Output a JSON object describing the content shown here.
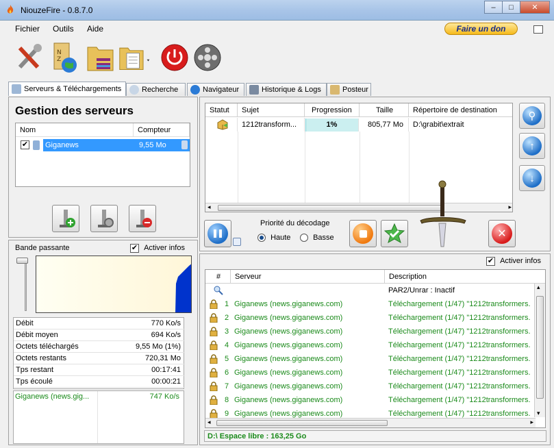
{
  "window": {
    "title": "NiouzeFire - 0.8.7.0",
    "controls": {
      "minimize": "–",
      "maximize": "□",
      "close": "✕"
    }
  },
  "menu": {
    "fichier": "Fichier",
    "outils": "Outils",
    "aide": "Aide",
    "donate": "Faire un don"
  },
  "toolbar": {
    "icons": [
      "tools-icon",
      "nzb-globe-icon",
      "archive-folder-icon",
      "document-folder-icon",
      "power-icon",
      "reel-icon"
    ]
  },
  "tabs": [
    {
      "label": "Serveurs & Téléchargements",
      "active": true
    },
    {
      "label": "Recherche"
    },
    {
      "label": "Navigateur"
    },
    {
      "label": "Historique & Logs"
    },
    {
      "label": "Posteur"
    }
  ],
  "servers": {
    "title": "Gestion des serveurs",
    "columns": {
      "name": "Nom",
      "counter": "Compteur"
    },
    "rows": [
      {
        "name": "Giganews",
        "counter": "9,55 Mo",
        "checked": true
      }
    ]
  },
  "bandwidth": {
    "label": "Bande passante",
    "activer_infos": "Activer infos",
    "stats": [
      {
        "label": "Débit",
        "value": "770 Ko/s"
      },
      {
        "label": "Débit moyen",
        "value": "694 Ko/s"
      },
      {
        "label": "Octets téléchargés",
        "value": "9,55 Mo (1%)"
      },
      {
        "label": "Octets restants",
        "value": "720,31 Mo"
      },
      {
        "label": "Tps restant",
        "value": "00:17:41"
      },
      {
        "label": "Tps écoulé",
        "value": "00:00:21"
      }
    ],
    "server_speed": {
      "name": "Giganews (news.gig...",
      "value": "747 Ko/s"
    }
  },
  "downloads": {
    "columns": {
      "statut": "Statut",
      "sujet": "Sujet",
      "progression": "Progression",
      "taille": "Taille",
      "repertoire": "Répertoire de destination"
    },
    "rows": [
      {
        "sujet": "1212transform...",
        "progression": "1%",
        "progress_fraction": 0.01,
        "taille": "805,77 Mo",
        "repertoire": "D:\\grabit\\extrait"
      }
    ]
  },
  "controls": {
    "priority_label": "Priorité du décodage",
    "haute": "Haute",
    "basse": "Basse",
    "selected": "Haute"
  },
  "log": {
    "activer_infos": "Activer infos",
    "columns": {
      "num": "#",
      "serveur": "Serveur",
      "description": "Description"
    },
    "par2_row": "PAR2/Unrar : Inactif",
    "rows": [
      {
        "num": "1",
        "serveur": "Giganews (news.giganews.com)",
        "description": "Téléchargement (1/47) \"1212transformers."
      },
      {
        "num": "2",
        "serveur": "Giganews (news.giganews.com)",
        "description": "Téléchargement (1/47) \"1212transformers."
      },
      {
        "num": "3",
        "serveur": "Giganews (news.giganews.com)",
        "description": "Téléchargement (1/47) \"1212transformers."
      },
      {
        "num": "4",
        "serveur": "Giganews (news.giganews.com)",
        "description": "Téléchargement (1/47) \"1212transformers."
      },
      {
        "num": "5",
        "serveur": "Giganews (news.giganews.com)",
        "description": "Téléchargement (1/47) \"1212transformers."
      },
      {
        "num": "6",
        "serveur": "Giganews (news.giganews.com)",
        "description": "Téléchargement (1/47) \"1212transformers."
      },
      {
        "num": "7",
        "serveur": "Giganews (news.giganews.com)",
        "description": "Téléchargement (1/47) \"1212transformers."
      },
      {
        "num": "8",
        "serveur": "Giganews (news.giganews.com)",
        "description": "Téléchargement (1/47) \"1212transformers."
      },
      {
        "num": "9",
        "serveur": "Giganews (news.giganews.com)",
        "description": "Téléchargement (1/47) \"1212transformers."
      }
    ]
  },
  "status": {
    "free_space": "D:\\ Espace libre : 163,25 Go"
  },
  "colors": {
    "accent": "#3399ff",
    "log_text": "#1a8a1a",
    "graph_fill": "#0033cc"
  }
}
